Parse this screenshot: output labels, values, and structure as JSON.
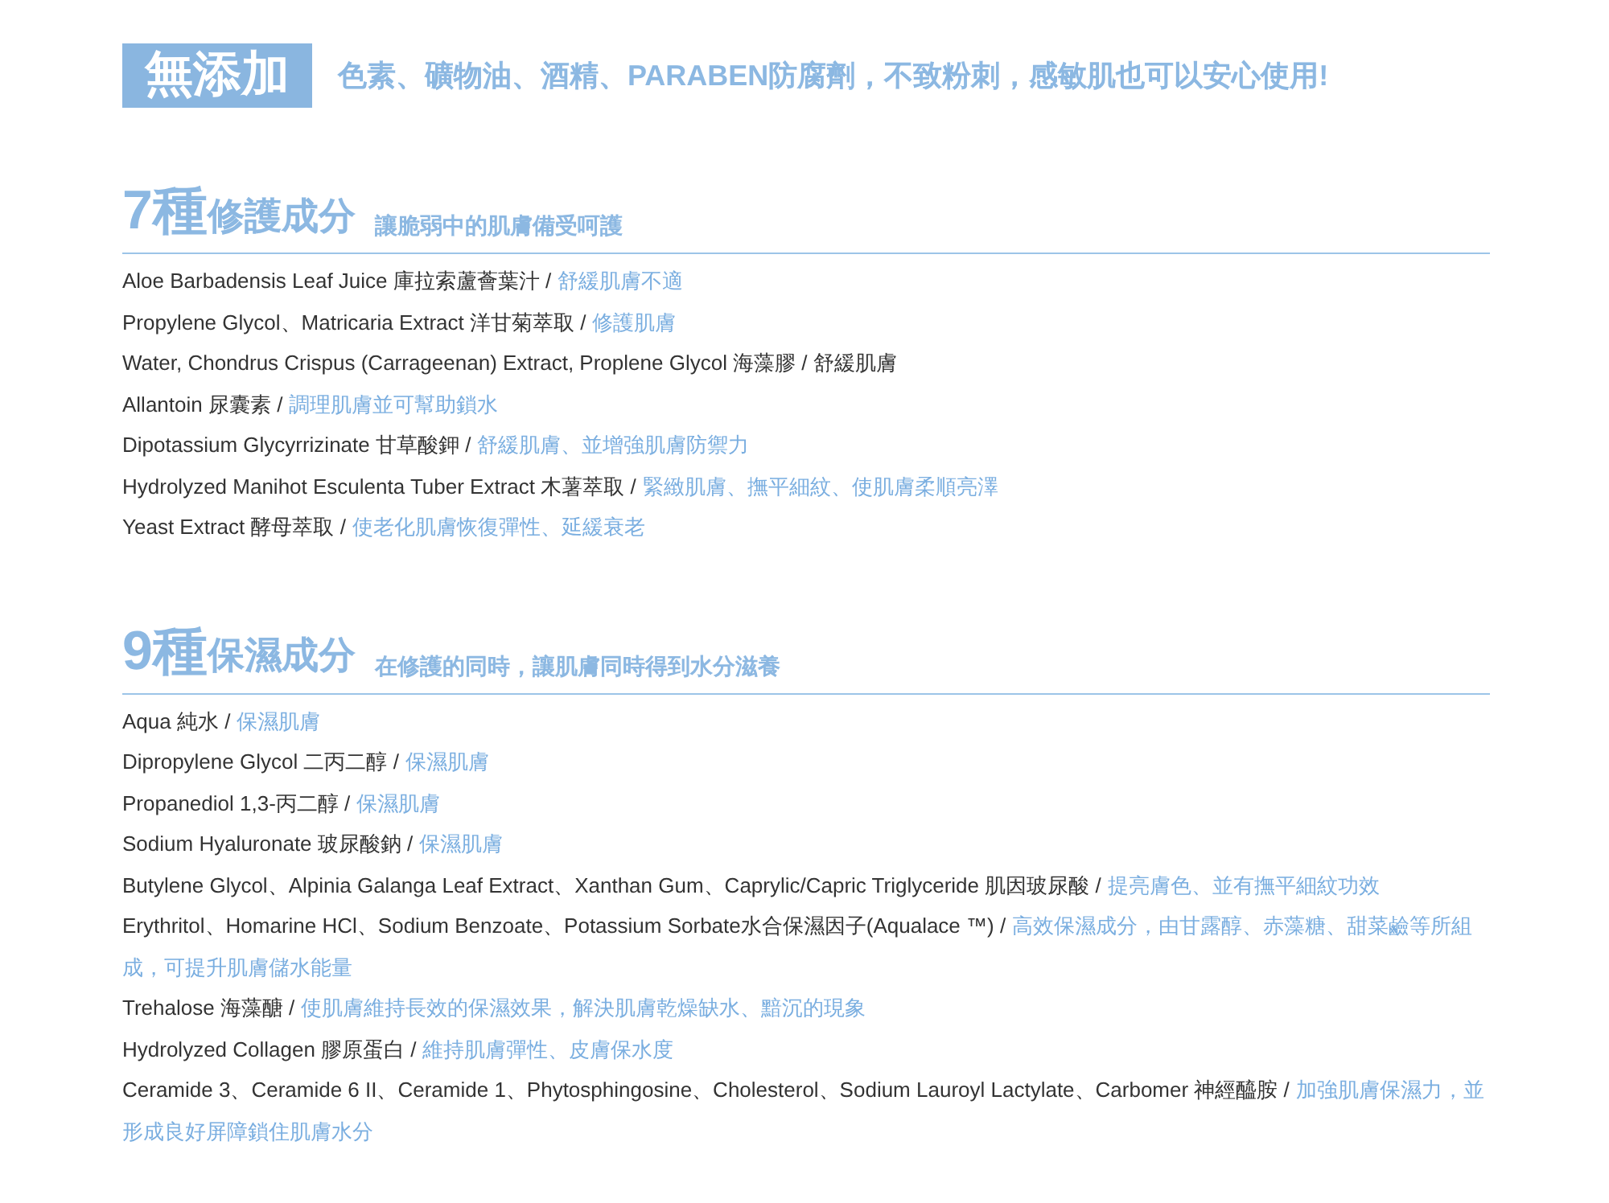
{
  "banner": {
    "badge": "無添加",
    "text": "色素、礦物油、酒精、PARABEN防腐劑，不致粉刺，感敏肌也可以安心使用!"
  },
  "sections": [
    {
      "count": "7種",
      "title": "修護成分",
      "subtitle": "讓脆弱中的肌膚備受呵護",
      "items": [
        {
          "ingredient": "Aloe Barbadensis Leaf Juice 庫拉索蘆薈葉汁 /",
          "benefit": "舒緩肌膚不適",
          "highlighted": true
        },
        {
          "ingredient": "Propylene Glycol、Matricaria Extract 洋甘菊萃取 /",
          "benefit": "修護肌膚",
          "highlighted": true
        },
        {
          "ingredient": "Water, Chondrus Crispus (Carrageenan) Extract, Proplene Glycol 海藻膠 /",
          "benefit": "舒緩肌膚",
          "highlighted": false
        },
        {
          "ingredient": "Allantoin 尿囊素 /",
          "benefit": "調理肌膚並可幫助鎖水",
          "highlighted": true
        },
        {
          "ingredient": "Dipotassium Glycyrrizinate 甘草酸鉀 /",
          "benefit": "舒緩肌膚、並增強肌膚防禦力",
          "highlighted": true
        },
        {
          "ingredient": "Hydrolyzed Manihot Esculenta Tuber Extract 木薯萃取 /",
          "benefit": "緊緻肌膚、撫平細紋、使肌膚柔順亮澤",
          "highlighted": true
        },
        {
          "ingredient": "Yeast Extract 酵母萃取 /",
          "benefit": "使老化肌膚恢復彈性、延緩衰老",
          "highlighted": true
        }
      ]
    },
    {
      "count": "9種",
      "title": "保濕成分",
      "subtitle": "在修護的同時，讓肌膚同時得到水分滋養",
      "items": [
        {
          "ingredient": "Aqua 純水 /",
          "benefit": "保濕肌膚",
          "highlighted": true
        },
        {
          "ingredient": "Dipropylene Glycol 二丙二醇 /",
          "benefit": "保濕肌膚",
          "highlighted": true
        },
        {
          "ingredient": "Propanediol 1,3-丙二醇 /",
          "benefit": "保濕肌膚",
          "highlighted": true
        },
        {
          "ingredient": "Sodium Hyaluronate 玻尿酸鈉 /",
          "benefit": "保濕肌膚",
          "highlighted": true
        },
        {
          "ingredient": "Butylene Glycol、Alpinia Galanga Leaf Extract、Xanthan Gum、Caprylic/Capric Triglyceride 肌因玻尿酸 /",
          "benefit": "提亮膚色、並有撫平細紋功效",
          "highlighted": true
        },
        {
          "ingredient": "Erythritol、Homarine HCl、Sodium Benzoate、Potassium Sorbate水合保濕因子(Aqualace ™) /",
          "benefit": "高效保濕成分，由甘露醇、赤藻糖、甜菜鹼等所組成，可提升肌膚儲水能量",
          "highlighted": true
        },
        {
          "ingredient": "Trehalose 海藻醣 /",
          "benefit": "使肌膚維持長效的保濕效果，解決肌膚乾燥缺水、黯沉的現象",
          "highlighted": true
        },
        {
          "ingredient": "Hydrolyzed Collagen 膠原蛋白 /",
          "benefit": "維持肌膚彈性、皮膚保水度",
          "highlighted": true
        },
        {
          "ingredient": "Ceramide 3、Ceramide 6 II、Ceramide 1、Phytosphingosine、Cholesterol、Sodium Lauroyl Lactylate、Carbomer 神經醯胺 /",
          "benefit": "加強肌膚保濕力，並形成良好屏障鎖住肌膚水分",
          "highlighted": true
        }
      ]
    }
  ]
}
